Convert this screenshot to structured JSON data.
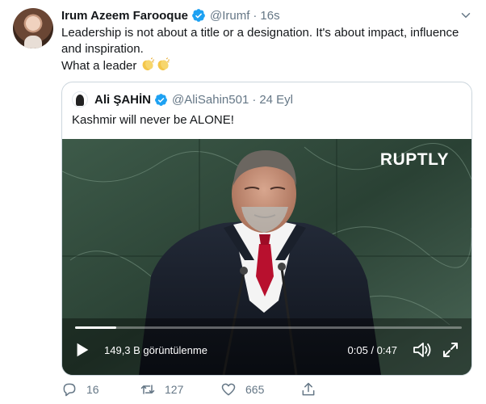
{
  "tweet": {
    "author_name": "Irum Azeem Farooque",
    "handle": "@Irumf",
    "separator": "·",
    "time": "16s",
    "text_lines": [
      "Leadership is not about a title or a designation. It's about impact, influence",
      "and inspiration.",
      "What a leader"
    ],
    "emoji": [
      "clapping-hands",
      "clapping-hands"
    ],
    "icons": {
      "verified": "verified-badge-icon",
      "more": "chevron-down-icon"
    }
  },
  "quote": {
    "author_name": "Ali ŞAHİN",
    "handle": "@AliSahin501",
    "separator": "·",
    "time": "24 Eyl",
    "text": "Kashmir will never be ALONE!",
    "video": {
      "watermark": "RUPTLY",
      "views": "149,3 B görüntülenme",
      "duration": "0:05 / 0:47",
      "progress": 0.106,
      "icons": [
        "play-icon",
        "volume-icon",
        "fullscreen-icon"
      ]
    }
  },
  "actions": {
    "reply_count": "16",
    "retweet_count": "127",
    "like_count": "665",
    "icons": [
      "reply-icon",
      "retweet-icon",
      "like-icon",
      "share-icon"
    ]
  },
  "colors": {
    "verified_blue": "#1da1f2",
    "secondary_text": "#657786",
    "border": "#ccd6dd"
  }
}
